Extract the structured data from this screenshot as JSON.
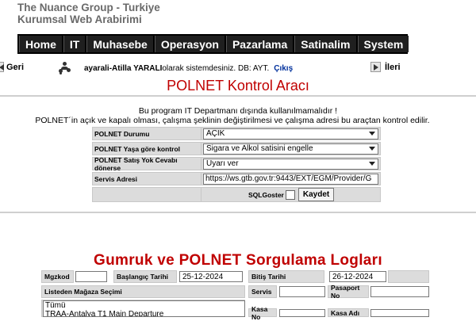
{
  "brand": {
    "line1": "The Nuance Group - Turkiye",
    "line2": "Kurumsal Web Arabirimi"
  },
  "nav": [
    "Home",
    "IT",
    "Muhasebe",
    "Operasyon",
    "Pazarlama",
    "Satinalim",
    "System"
  ],
  "subbar": {
    "back_label": "Geri",
    "user_name": "ayarali-Atilla YARALI",
    "login_text": " olarak sistemdesiniz. DB: AYT.",
    "logout_label": "Çıkış",
    "forward_label": "İleri"
  },
  "page_title": "POLNET Kontrol Aracı",
  "info_line1": "Bu program IT Departmanı dışında kullanılmamalıdır !",
  "info_line2": "POLNET´in açık ve kapalı olması, çalışma şeklinin değiştirilmesi ve çalışma adresi bu araçtan kontrol edilir.",
  "controls": {
    "status_label": "POLNET Durumu",
    "status_value": "AÇIK",
    "age_label": "POLNET Yaşa göre kontrol",
    "age_value": "Sigara ve Alkol satisini engelle",
    "no_reply_label": "POLNET Satış Yok Cevabı dönerse",
    "no_reply_value": "Uyarı ver",
    "service_label": "Servis Adresi",
    "service_value": "https://ws.gtb.gov.tr:9443/EXT/EGM/Provider/G",
    "sqlgoster_label": "SQLGoster",
    "save_label": "Kaydet"
  },
  "logs": {
    "title": "Gumruk ve POLNET Sorgulama Logları",
    "mgzkod_label": "Mgzkod",
    "mgzkod_value": "",
    "start_label": "Başlangıç Tarihi",
    "start_value": "25-12-2024",
    "end_label": "Bitiş Tarihi",
    "end_value": "26-12-2024",
    "store_label": "Listeden Mağaza Seçimi",
    "store_options": [
      "Tümü",
      "TRAA-Antalya T1 Main Departure"
    ],
    "servis_label": "Servis",
    "servis_value": "",
    "passport_label": "Pasaport No",
    "passport_value": "",
    "kasa_no_label": "Kasa No",
    "kasa_adi_label": "Kasa Adı"
  }
}
